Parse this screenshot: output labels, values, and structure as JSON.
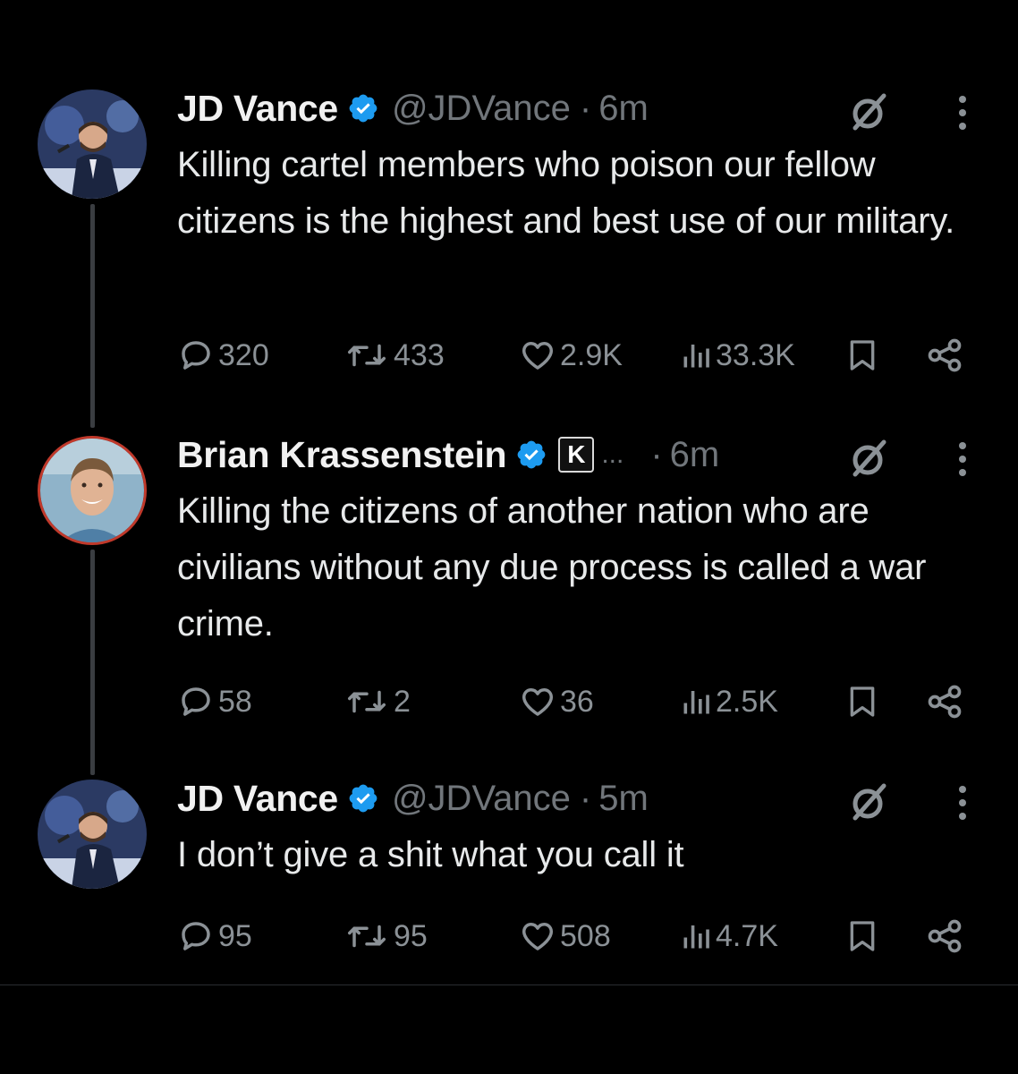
{
  "tweets": [
    {
      "name": "JD Vance",
      "handle": "@JDVance",
      "time": "6m",
      "text": "Killing cartel members who poison our fellow citizens is the highest and best use of our military.",
      "replies": "320",
      "reposts": "433",
      "likes": "2.9K",
      "views": "33.3K"
    },
    {
      "name": "Brian Krassenstein",
      "handle_badge": "K",
      "handle_ellipsis": "...",
      "time": "6m",
      "text": "Killing the citizens of another nation who are civilians without any due process is called a war crime.",
      "replies": "58",
      "reposts": "2",
      "likes": "36",
      "views": "2.5K"
    },
    {
      "name": "JD Vance",
      "handle": "@JDVance",
      "time": "5m",
      "text": "I don’t give a shit what you call it",
      "replies": "95",
      "reposts": "95",
      "likes": "508",
      "views": "4.7K"
    }
  ],
  "separator": "·",
  "icons": {
    "verified": "verified-badge-icon",
    "grok": "grok-icon",
    "more": "more-vertical-icon",
    "reply": "reply-icon",
    "repost": "repost-icon",
    "like": "heart-icon",
    "views": "views-chart-icon",
    "bookmark": "bookmark-icon",
    "share": "share-icon"
  },
  "colors": {
    "background": "#000000",
    "text": "#e7e9ea",
    "muted": "#71767b",
    "verified": "#1d9bf0"
  }
}
